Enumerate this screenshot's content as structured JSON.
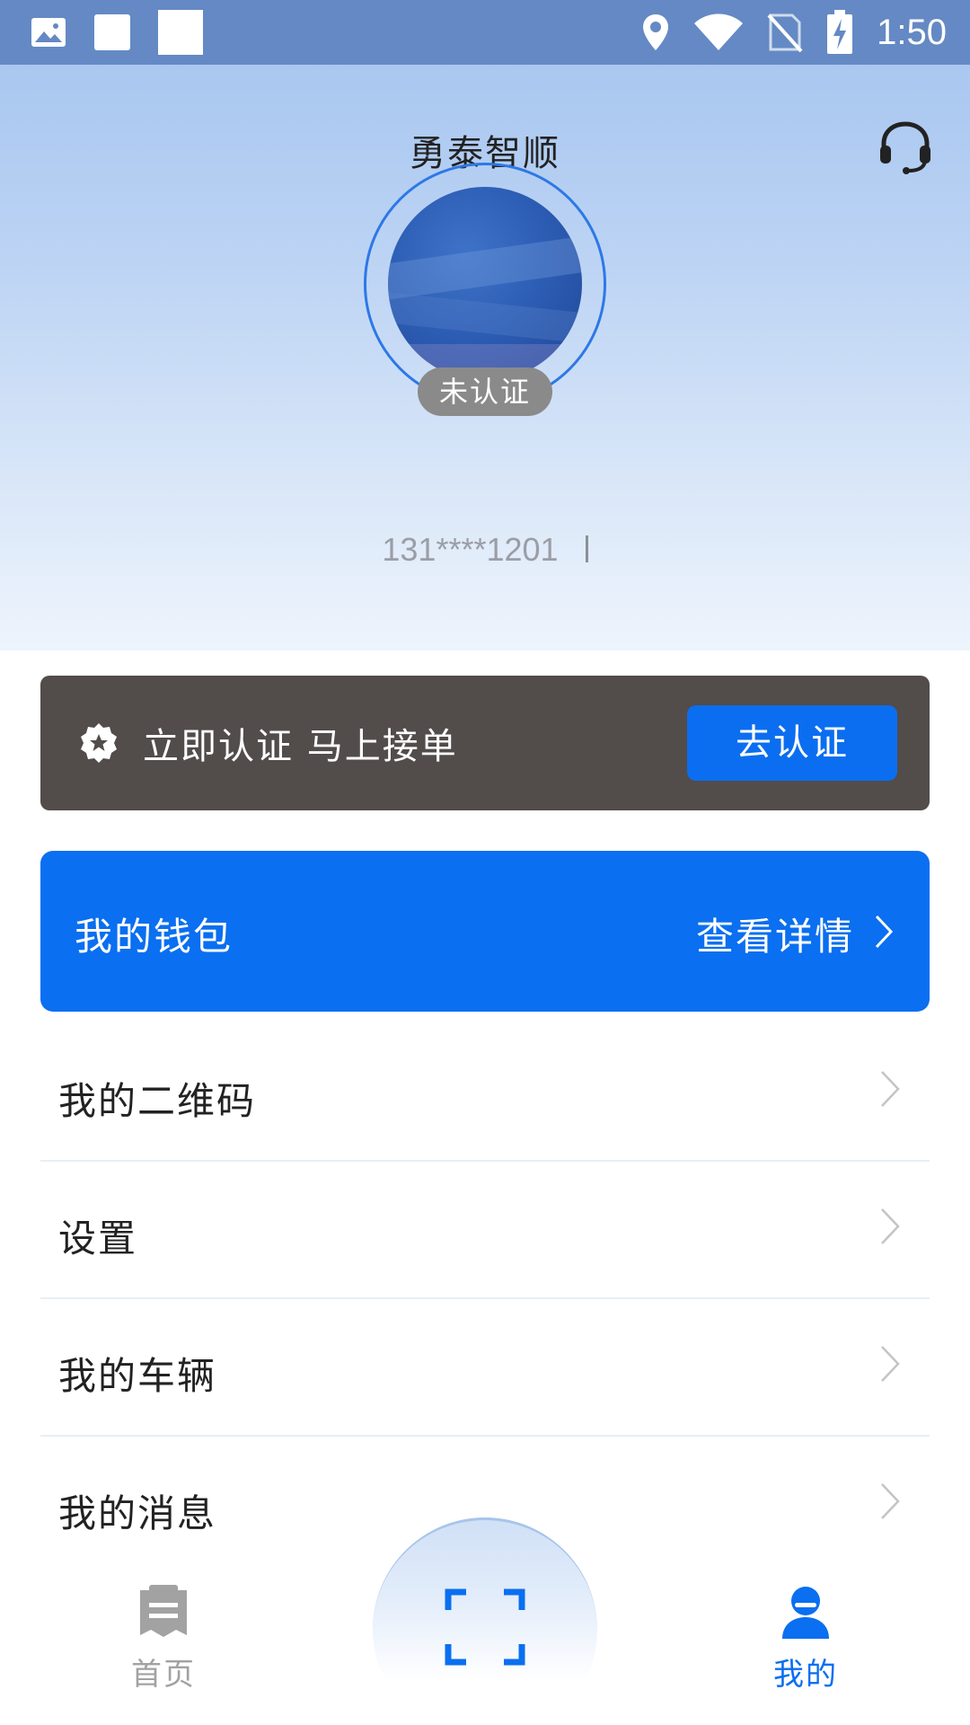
{
  "status_bar": {
    "time": "1:50",
    "icons": [
      "image-notification-icon",
      "square-notification-icon",
      "square-notification-icon",
      "location-icon",
      "wifi-icon",
      "no-sim-icon",
      "battery-charging-icon"
    ]
  },
  "header": {
    "title": "勇泰智顺",
    "support_icon": "headset-icon",
    "cert_badge": "未认证",
    "phone": "131****1201"
  },
  "cert_banner": {
    "icon": "badge-icon",
    "text": "立即认证 马上接单",
    "button": "去认证"
  },
  "wallet": {
    "label": "我的钱包",
    "detail": "查看详情"
  },
  "menu": [
    {
      "label": "我的二维码"
    },
    {
      "label": "设置"
    },
    {
      "label": "我的车辆"
    },
    {
      "label": "我的消息"
    }
  ],
  "bottom_nav": {
    "home": "首页",
    "mine": "我的",
    "scan_icon": "scan-icon"
  },
  "colors": {
    "status_bar": "#6489c4",
    "accent": "#0a6ff0",
    "banner_bg": "#524c4b",
    "inactive": "#a2a2a2"
  }
}
